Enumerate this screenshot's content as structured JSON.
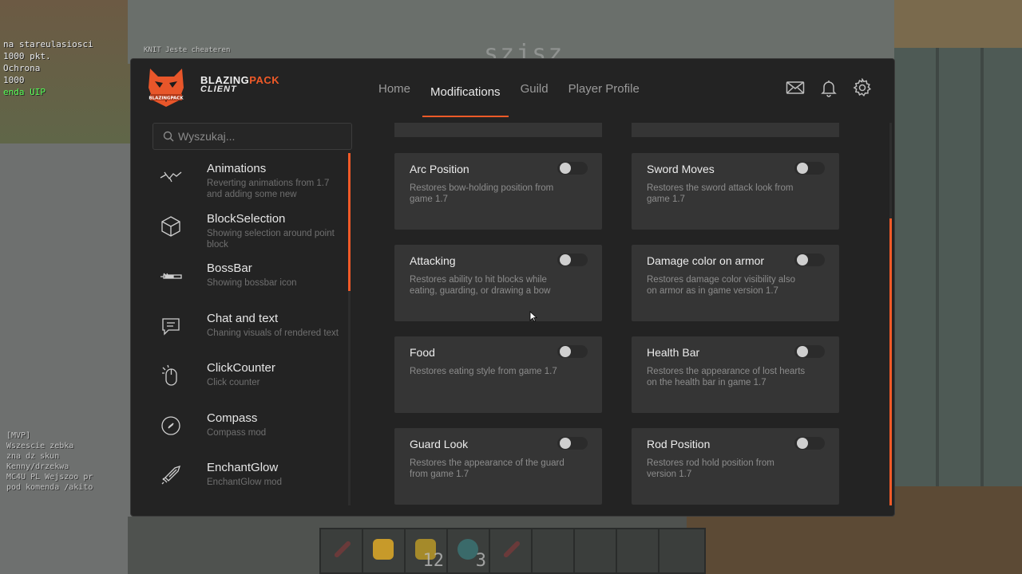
{
  "background": {
    "chat_lines": [
      {
        "text": "na stareulasiosci"
      },
      {
        "text": "   1000 pkt."
      },
      {
        "text": "            Ochrona"
      },
      {
        "text": "             1000"
      },
      {
        "text": "enda UIP"
      }
    ],
    "chat_top_right": "KNIT Jeste cheateren",
    "nametag": "szjsz",
    "chat_lower": [
      "[MVP]",
      "Wszescie  zebka",
      "zna dz skun",
      "Kenny/drzekwa",
      "MC4U PL  Wejszoo pr",
      "pod komenda /akito"
    ],
    "hotbar_counts": [
      "",
      "",
      "",
      "12",
      "3",
      "",
      "",
      "",
      ""
    ]
  },
  "brand": {
    "name_part1": "BLAZING",
    "name_part2": "PACK",
    "sub": "CLIENT",
    "accent": "#f05a28"
  },
  "nav": {
    "tabs": [
      {
        "label": "Home"
      },
      {
        "label": "Modifications"
      },
      {
        "label": "Guild"
      },
      {
        "label": "Player Profile"
      }
    ],
    "active": "Modifications"
  },
  "header_icons": [
    "mail-icon",
    "bell-icon",
    "gear-icon"
  ],
  "search": {
    "placeholder": "Wyszukaj..."
  },
  "sidebar": {
    "items": [
      {
        "title": "Animations",
        "desc": "Reverting animations from 1.7 and adding some new",
        "icon": "bird-icon"
      },
      {
        "title": "BlockSelection",
        "desc": "Showing selection around point block",
        "icon": "cube-icon"
      },
      {
        "title": "BossBar",
        "desc": "Showing bossbar icon",
        "icon": "bossbar-icon"
      },
      {
        "title": "Chat and text",
        "desc": "Chaning visuals of rendered text",
        "icon": "chat-icon"
      },
      {
        "title": "ClickCounter",
        "desc": "Click counter",
        "icon": "mouse-click-icon"
      },
      {
        "title": "Compass",
        "desc": "Compass mod",
        "icon": "compass-icon"
      },
      {
        "title": "EnchantGlow",
        "desc": "EnchantGlow mod",
        "icon": "sword-icon"
      }
    ]
  },
  "mods": [
    {
      "title": "Arc Position",
      "desc": "Restores bow-holding position from game 1.7",
      "enabled": false
    },
    {
      "title": "Sword Moves",
      "desc": "Restores the sword attack look from game 1.7",
      "enabled": false
    },
    {
      "title": "Attacking",
      "desc": "Restores ability to hit blocks while eating, guarding, or drawing a bow",
      "enabled": false
    },
    {
      "title": "Damage color on armor",
      "desc": "Restores damage color visibility also on armor as in game version 1.7",
      "enabled": false
    },
    {
      "title": "Food",
      "desc": "Restores eating style from game 1.7",
      "enabled": false
    },
    {
      "title": "Health Bar",
      "desc": "Restores the appearance of lost hearts on the health bar in game 1.7",
      "enabled": false
    },
    {
      "title": "Guard Look",
      "desc": "Restores the appearance of the guard from game 1.7",
      "enabled": false
    },
    {
      "title": "Rod Position",
      "desc": "Restores rod hold position from version 1.7",
      "enabled": false
    }
  ]
}
